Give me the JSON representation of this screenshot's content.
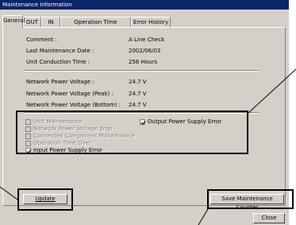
{
  "window": {
    "title": "Maintenance Information"
  },
  "tabs": [
    {
      "label": "General",
      "active": true
    },
    {
      "label": "OUT",
      "active": false
    },
    {
      "label": "IN",
      "active": false
    },
    {
      "label": "Operation Time",
      "active": false
    },
    {
      "label": "Error History",
      "active": false
    }
  ],
  "info": {
    "comment_label": "Comment :",
    "comment_value": "A Line Check",
    "last_date_label": "Last Maintenance Date :",
    "last_date_value": "2002/06/03",
    "conduction_label": "Unit Conduction Time :",
    "conduction_value": "256 Hours",
    "voltage_label": "Network Power Voltage :",
    "voltage_value": "24.7 V",
    "voltage_peak_label": "Network Power Voltage (Peak) :",
    "voltage_peak_value": "24.7 V",
    "voltage_bottom_label": "Network Power Voltage (Bottom) :",
    "voltage_bottom_value": "24.7 V"
  },
  "status": {
    "unit_maintenance": {
      "label": "Unit Maintenance",
      "checked": false
    },
    "voltage_drop": {
      "label": "Network Power Voltage drop",
      "checked": false
    },
    "connected_component": {
      "label": "Connected Component Maintenance",
      "checked": false
    },
    "operation_time_over": {
      "label": "Operation Time Over",
      "checked": false
    },
    "input_power_error": {
      "label": "Input Power Supply Error",
      "checked": true
    },
    "output_power_error": {
      "label": "Output Power Supply Error",
      "checked": true
    }
  },
  "buttons": {
    "update": "Update",
    "save_counter": "Save Maintenance Counter",
    "close": "Close"
  }
}
